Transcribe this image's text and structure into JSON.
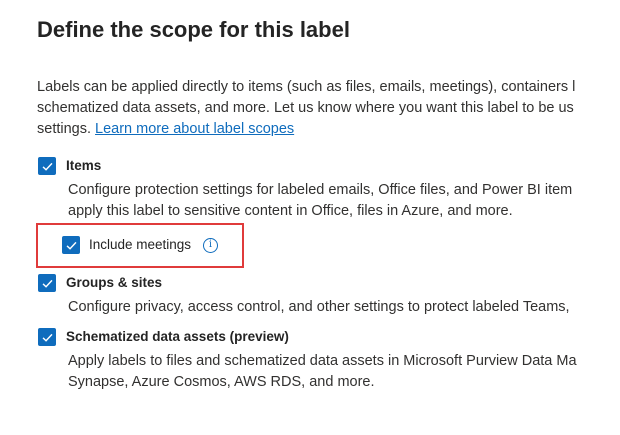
{
  "page": {
    "title": "Define the scope for this label",
    "intro_line1": "Labels can be applied directly to items (such as files, emails, meetings), containers l",
    "intro_line2": "schematized data assets, and more. Let us know where you want this label to be us",
    "intro_line3": "settings.",
    "learn_more_link": "Learn more about label scopes"
  },
  "scopes": {
    "items": {
      "label": "Items",
      "checked": true,
      "desc_line1": "Configure protection settings for labeled emails, Office files, and Power BI item",
      "desc_line2": "apply this label to sensitive content in Office, files in Azure, and more.",
      "include_meetings": {
        "label": "Include meetings",
        "checked": true,
        "info_icon": "info-icon"
      }
    },
    "groups_sites": {
      "label": "Groups & sites",
      "checked": true,
      "desc_line1": "Configure privacy, access control, and other settings to protect labeled Teams,"
    },
    "schematized": {
      "label": "Schematized data assets (preview)",
      "checked": true,
      "desc_line1": "Apply labels to files and schematized data assets in Microsoft Purview Data Ma",
      "desc_line2": "Synapse, Azure Cosmos, AWS RDS, and more."
    }
  },
  "colors": {
    "accent": "#0f6cbd",
    "highlight_border": "#e03b3b",
    "text": "#323130"
  }
}
